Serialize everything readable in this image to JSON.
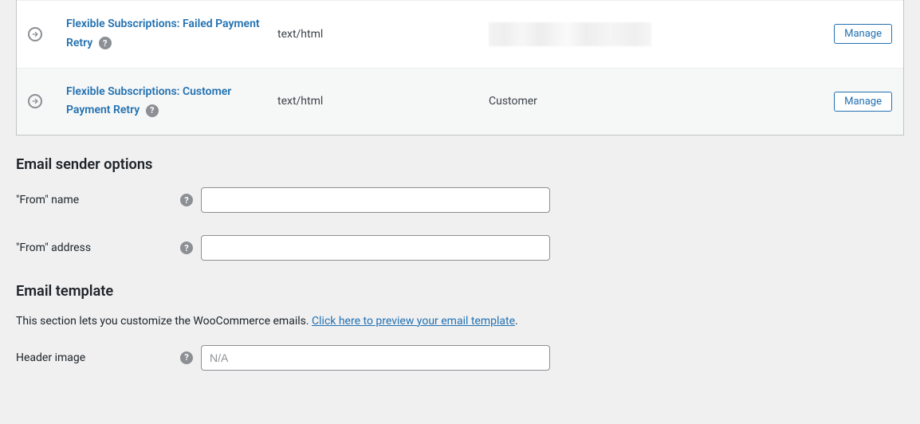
{
  "emails": [
    {
      "name": "Flexible Subscriptions: Failed Payment Retry",
      "content_type": "text/html",
      "recipient": "",
      "manage_label": "Manage",
      "blurred": true
    },
    {
      "name": "Flexible Subscriptions: Customer Payment Retry",
      "content_type": "text/html",
      "recipient": "Customer",
      "manage_label": "Manage",
      "blurred": false
    }
  ],
  "sections": {
    "sender_heading": "Email sender options",
    "template_heading": "Email template",
    "template_desc_prefix": "This section lets you customize the WooCommerce emails. ",
    "template_desc_link": "Click here to preview your email template",
    "template_desc_suffix": "."
  },
  "fields": {
    "from_name": {
      "label": "\"From\" name",
      "value": ""
    },
    "from_address": {
      "label": "\"From\" address",
      "value": ""
    },
    "header_image": {
      "label": "Header image",
      "placeholder": "N/A",
      "value": ""
    }
  },
  "help_glyph": "?"
}
